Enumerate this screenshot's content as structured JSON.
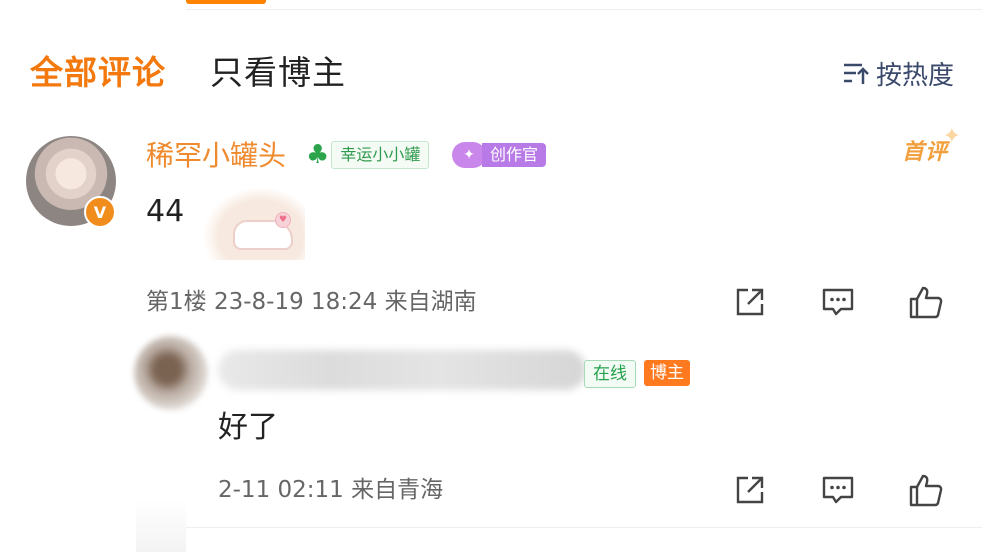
{
  "tabs": {
    "all_comments": "全部评论",
    "blogger_only": "只看博主",
    "sort_label": "按热度"
  },
  "comment": {
    "username": "稀罕小罐头",
    "badge_lucky": "幸运小小罐",
    "badge_creator": "创作官",
    "first_label": "首评",
    "content": "44",
    "floor": "第1楼",
    "time": "23-8-19 18:24",
    "location": "来自湖南",
    "verified_mark": "V"
  },
  "reply": {
    "badge_online": "在线",
    "badge_blogger": "博主",
    "content": "好了",
    "time": "2-11 02:11",
    "location": "来自青海"
  },
  "colors": {
    "accent": "#f3790e",
    "muted_text": "#666666"
  }
}
